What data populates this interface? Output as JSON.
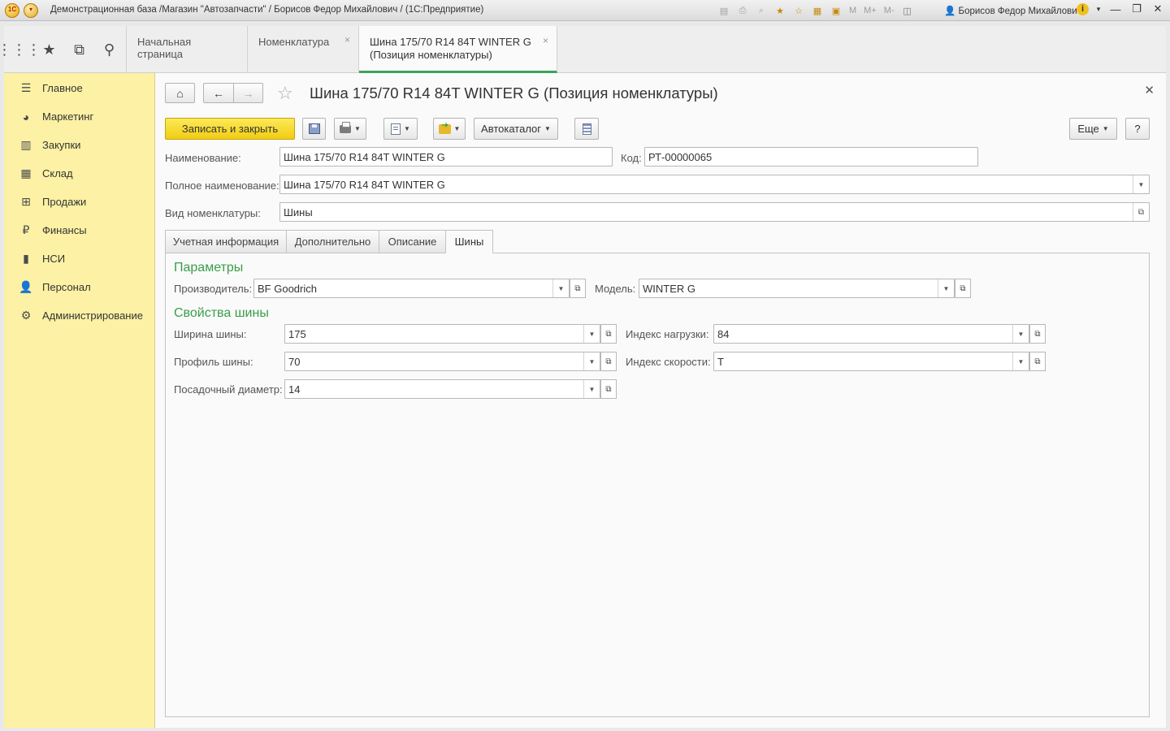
{
  "window": {
    "title": "Демонстрационная база /Магазин \"Автозапчасти\" / Борисов Федор Михайлович /  (1С:Предприятие)",
    "logo_text": "1С",
    "user": "Борисов Федор Михайлович",
    "mem_buttons": [
      "M",
      "M+",
      "M-"
    ]
  },
  "tabs": [
    {
      "label": "Начальная страница"
    },
    {
      "label": "Номенклатура"
    },
    {
      "label_line1": "Шина 175/70 R14 84T WINTER G",
      "label_line2": "(Позиция номенклатуры)"
    }
  ],
  "sidebar": {
    "items": [
      {
        "label": "Главное",
        "icon": "menu-lines-icon"
      },
      {
        "label": "Маркетинг",
        "icon": "pie-chart-icon"
      },
      {
        "label": "Закупки",
        "icon": "cart-icon"
      },
      {
        "label": "Склад",
        "icon": "warehouse-grid-icon"
      },
      {
        "label": "Продажи",
        "icon": "basket-icon"
      },
      {
        "label": "Финансы",
        "icon": "ruble-coin-icon"
      },
      {
        "label": "НСИ",
        "icon": "book-icon"
      },
      {
        "label": "Персонал",
        "icon": "person-icon"
      },
      {
        "label": "Администрирование",
        "icon": "gear-icon"
      }
    ]
  },
  "form": {
    "title": "Шина 175/70 R14 84T WINTER G (Позиция номенклатуры)",
    "toolbar": {
      "save_close": "Записать и закрыть",
      "autocatalog": "Автокаталог",
      "more": "Еще",
      "help": "?"
    },
    "fields": {
      "name_label": "Наименование:",
      "name_value": "Шина 175/70 R14 84T WINTER G",
      "code_label": "Код:",
      "code_value": "РТ-00000065",
      "fullname_label": "Полное наименование:",
      "fullname_value": "Шина 175/70 R14 84T WINTER G",
      "kind_label": "Вид номенклатуры:",
      "kind_value": "Шины"
    },
    "tabs": [
      "Учетная информация",
      "Дополнительно",
      "Описание",
      "Шины"
    ],
    "active_tab": "Шины",
    "tires": {
      "params_header": "Параметры",
      "maker_label": "Производитель:",
      "maker_value": "BF Goodrich",
      "model_label": "Модель:",
      "model_value": "WINTER G",
      "props_header": "Свойства шины",
      "width_label": "Ширина шины:",
      "width_value": "175",
      "load_label": "Индекс нагрузки:",
      "load_value": "84",
      "profile_label": "Профиль шины:",
      "profile_value": "70",
      "speed_label": "Индекс скорости:",
      "speed_value": "T",
      "diameter_label": "Посадочный диаметр:",
      "diameter_value": "14"
    }
  },
  "colors": {
    "sidebar_bg": "#fcf1a4",
    "primary_button": "#f2cc12",
    "group_header": "#3a9d4a",
    "active_tab_underline": "#3da35d"
  }
}
